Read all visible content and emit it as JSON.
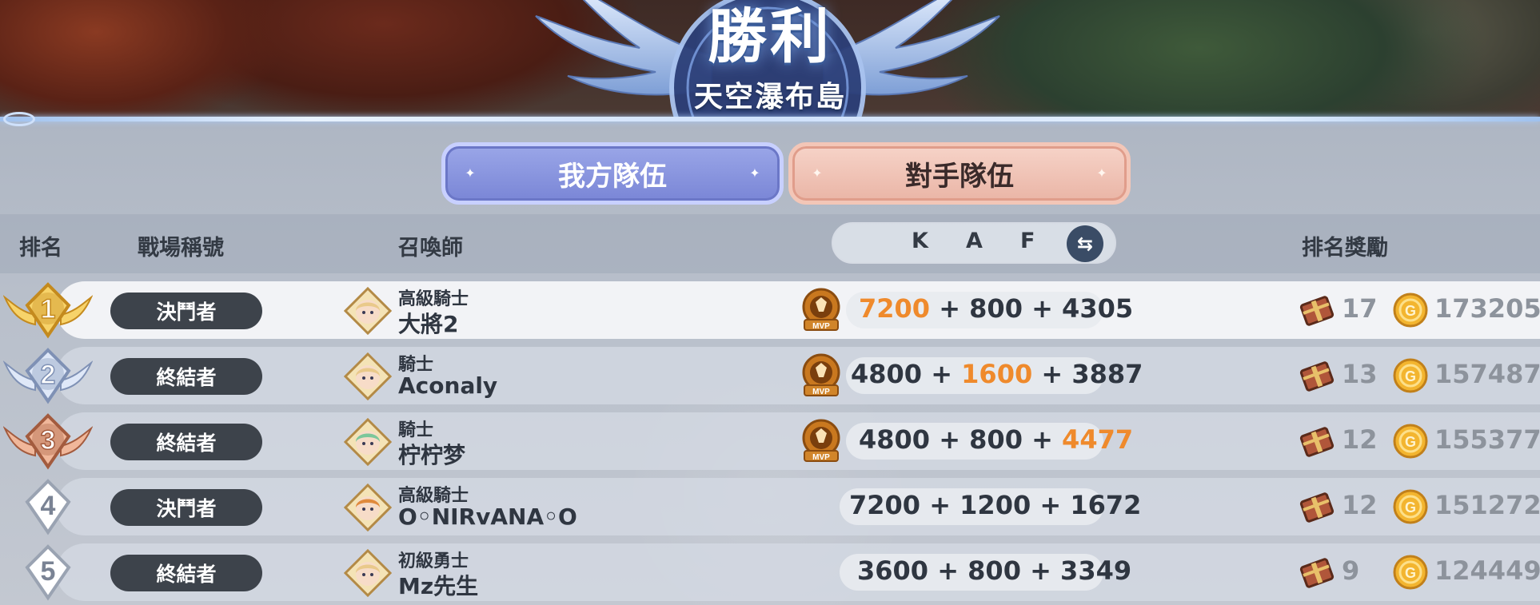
{
  "header": {
    "title": "勝利",
    "subtitle": "天空瀑布島"
  },
  "tabs": [
    {
      "label": "我方隊伍",
      "active": true,
      "color": "#8592dd"
    },
    {
      "label": "對手隊伍",
      "active": false,
      "color": "#efc0b2"
    }
  ],
  "columns": {
    "rank": "排名",
    "battle_title": "戰場稱號",
    "summoner": "召喚師",
    "k": "K",
    "a": "A",
    "f": "F",
    "reward": "排名獎勵"
  },
  "colors": {
    "highlight_value": "#ef8a2c",
    "title_pill": "#3d434b",
    "gold_badge": "#e7b84a",
    "silver_badge": "#b6c3dc",
    "bronze_badge": "#d9957a"
  },
  "rows": [
    {
      "rank": "1",
      "badge": "gold-wings",
      "battle_title": "決鬥者",
      "summoner_rank": "高級騎士",
      "name": "大將2",
      "avatar": "blonde-knight-avatar",
      "mvp": "mvp-knight-icon",
      "k": "7200",
      "a": "800",
      "f": "4305",
      "highlight": "k",
      "chest": "17",
      "gold": "173205"
    },
    {
      "rank": "2",
      "badge": "silver-wings",
      "battle_title": "終結者",
      "summoner_rank": "騎士",
      "name": "Aconaly",
      "avatar": "blonde-knight-avatar",
      "mvp": "mvp-assist-icon",
      "k": "4800",
      "a": "1600",
      "f": "3887",
      "highlight": "a",
      "chest": "13",
      "gold": "157487"
    },
    {
      "rank": "3",
      "badge": "bronze-wings",
      "battle_title": "終結者",
      "summoner_rank": "騎士",
      "name": "柠柠梦",
      "avatar": "green-hair-avatar",
      "mvp": "mvp-skull-icon",
      "k": "4800",
      "a": "800",
      "f": "4477",
      "highlight": "f",
      "chest": "12",
      "gold": "155377"
    },
    {
      "rank": "4",
      "badge": "plain-diamond",
      "battle_title": "決鬥者",
      "summoner_rank": "高級騎士",
      "name": "O◦NIRvANA◦O",
      "avatar": "orange-hair-avatar",
      "mvp": "",
      "k": "7200",
      "a": "1200",
      "f": "1672",
      "highlight": "",
      "chest": "12",
      "gold": "151272"
    },
    {
      "rank": "5",
      "badge": "plain-diamond",
      "battle_title": "終結者",
      "summoner_rank": "初級勇士",
      "name": "Mz先生",
      "avatar": "blonde-knight-avatar",
      "mvp": "",
      "k": "3600",
      "a": "800",
      "f": "3349",
      "highlight": "",
      "chest": "9",
      "gold": "124449"
    }
  ]
}
